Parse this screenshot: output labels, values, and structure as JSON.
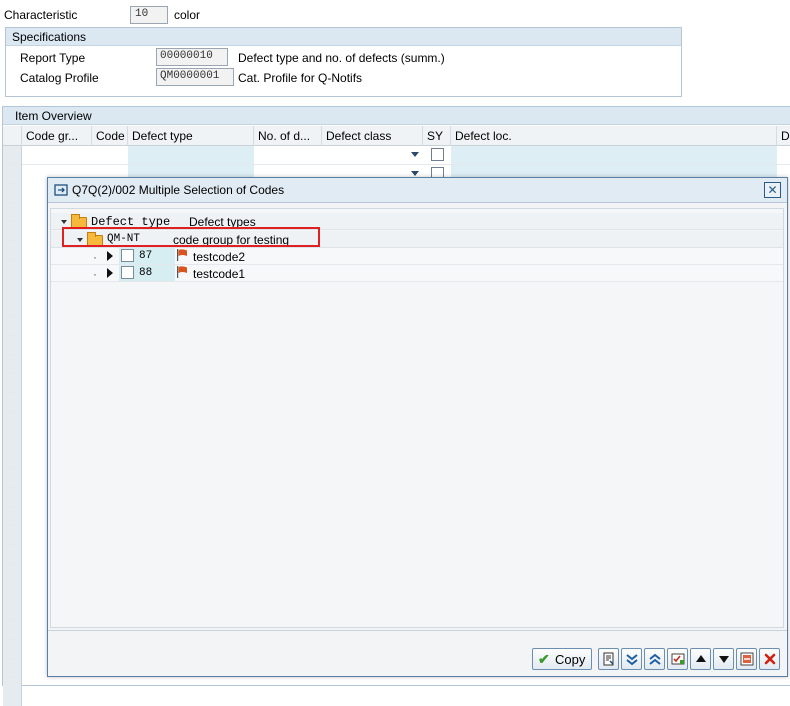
{
  "characteristic": {
    "label": "Characteristic",
    "number": "10",
    "value": "color"
  },
  "specifications": {
    "title": "Specifications",
    "report_type_label": "Report Type",
    "report_type_code": "00000010",
    "report_type_desc": "Defect type and no. of defects (summ.)",
    "catalog_profile_label": "Catalog Profile",
    "catalog_profile_code": "QM0000001",
    "catalog_profile_desc": "Cat. Profile for Q-Notifs"
  },
  "item_overview": {
    "title": "Item Overview",
    "columns": [
      "Code gr...",
      "Code",
      "Defect type",
      "No. of d...",
      "Defect class",
      "SY",
      "Defect loc.",
      "De"
    ]
  },
  "dialog": {
    "title": "Q7Q(2)/002 Multiple Selection of Codes",
    "close_icon": "close-icon",
    "tree": {
      "root": {
        "code": "Defect type",
        "text": "Defect types"
      },
      "group": {
        "code": "QM-NT",
        "text": "code group for testing"
      },
      "items": [
        {
          "code": "87",
          "text": "testcode2"
        },
        {
          "code": "88",
          "text": "testcode1"
        }
      ]
    },
    "footer": {
      "copy_label": "Copy",
      "toolbar_icons": [
        "details-icon",
        "expand-all-icon",
        "collapse-all-icon",
        "select-all-icon",
        "move-up-icon",
        "move-down-icon",
        "deselect-icon",
        "cancel-icon"
      ]
    }
  },
  "colors": {
    "highlight": "#e02020",
    "header_blue": "#dbe8f2",
    "folder": "#f6b93b",
    "flag": "#d9541e"
  }
}
